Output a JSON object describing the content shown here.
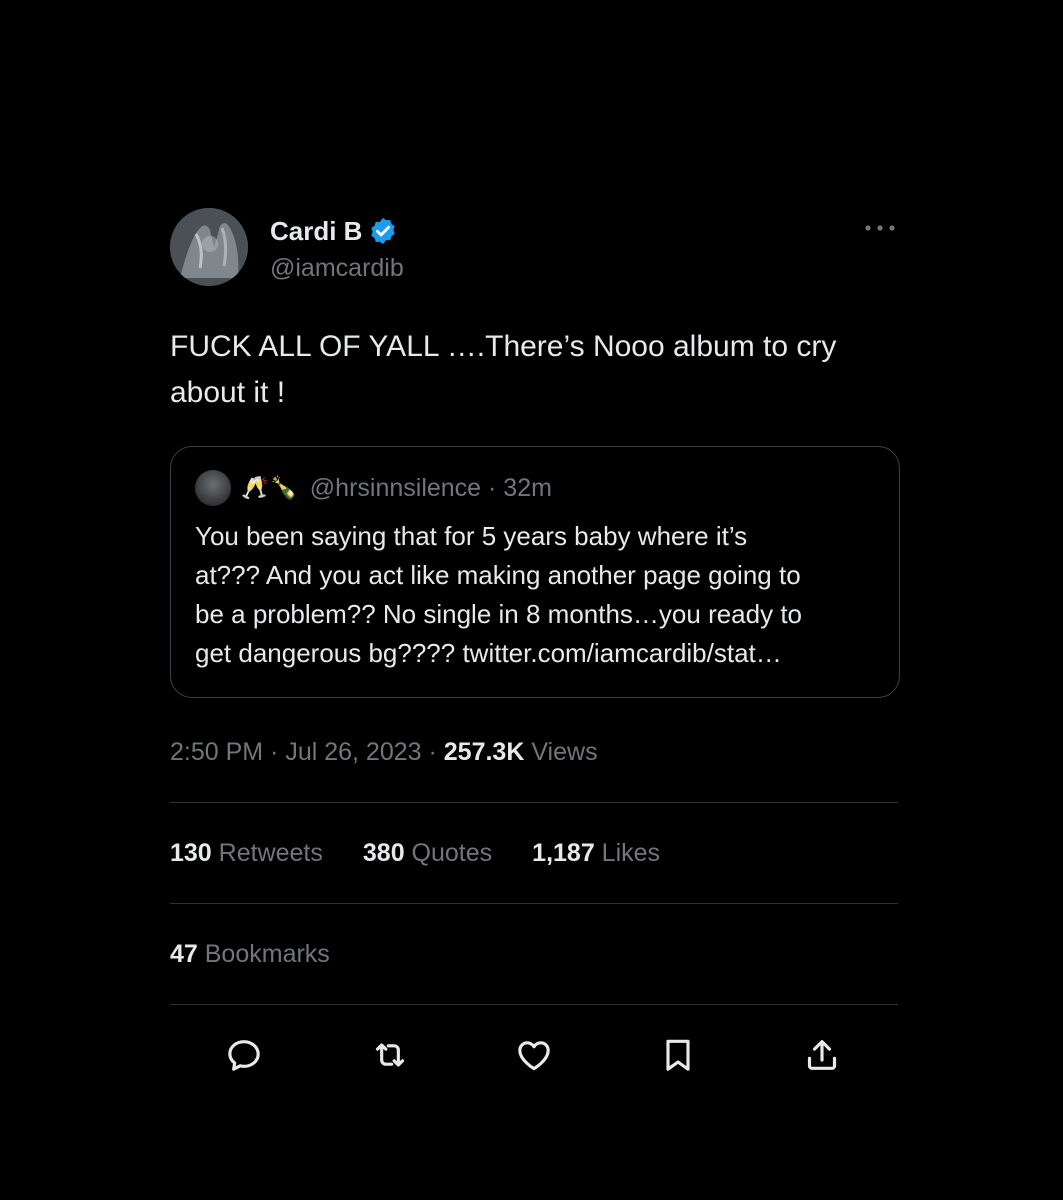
{
  "tweet": {
    "author": {
      "display_name": "Cardi B",
      "handle": "@iamcardib",
      "verified": true,
      "avatar_icon": "profile-photo"
    },
    "more_icon": "more-horizontal-icon",
    "text_line1": "FUCK ALL OF YALL ….There’s Nooo album to cry",
    "text_line2": "about it !",
    "quote": {
      "emoji": "🥂🍾",
      "handle_time": "@hrsinnsilence · 32m",
      "text_lines": [
        "You been saying that for 5 years baby where it’s",
        "at??? And you act like making another page going to",
        "be a problem?? No single in 8 months…you ready to",
        "get dangerous bg???? twitter.com/iamcardib/stat…"
      ]
    },
    "timestamp": "2:50 PM · Jul 26, 2023 · ",
    "views_count": "257.3K",
    "views_label": " Views",
    "stats": {
      "retweets_count": "130",
      "retweets_label": " Retweets",
      "quotes_count": "380",
      "quotes_label": " Quotes",
      "likes_count": "1,187",
      "likes_label": " Likes",
      "bookmarks_count": "47",
      "bookmarks_label": " Bookmarks"
    },
    "actions": [
      "reply-icon",
      "retweet-icon",
      "like-icon",
      "bookmark-icon",
      "share-icon"
    ]
  },
  "colors": {
    "background": "#000000",
    "text_primary": "#e7e9ea",
    "text_secondary": "#71767b",
    "verified_blue": "#1d9bf0",
    "border": "#2f3336"
  }
}
